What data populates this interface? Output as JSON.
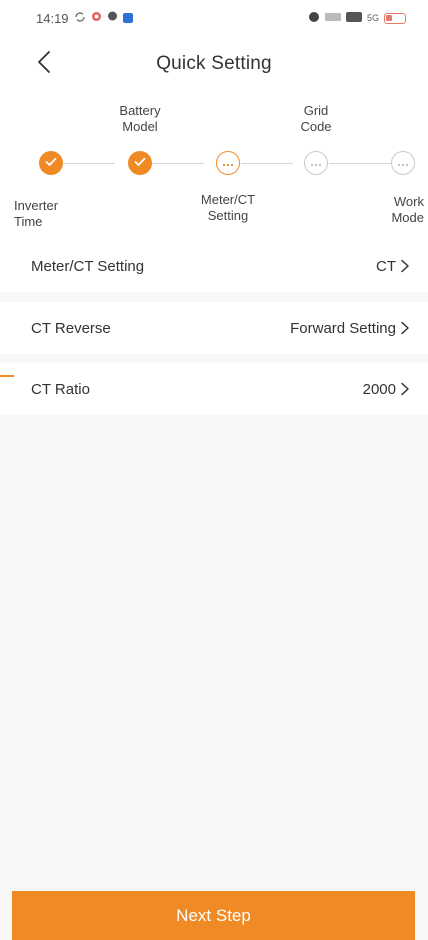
{
  "status_bar": {
    "time": "14:19",
    "right_text": "5G",
    "icons": [
      "sync-icon",
      "app-icon",
      "chat-icon",
      "notification-icon",
      "alarm-icon",
      "speed-icon",
      "hd-icon",
      "signal-icon",
      "battery-icon"
    ]
  },
  "header": {
    "title": "Quick Setting",
    "back_icon": "chevron-left-icon"
  },
  "stepper": {
    "accent_color": "#ef8a25",
    "steps": [
      {
        "label": "Inverter\nTime",
        "status": "done"
      },
      {
        "label": "Battery\nModel",
        "status": "done"
      },
      {
        "label": "Meter/CT\nSetting",
        "status": "current"
      },
      {
        "label": "Grid\nCode",
        "status": "todo"
      },
      {
        "label": "Work\nMode",
        "status": "todo"
      }
    ]
  },
  "settings": {
    "items": [
      {
        "label": "Meter/CT Setting",
        "value": "CT"
      },
      {
        "label": "CT Reverse",
        "value": "Forward Setting"
      },
      {
        "label": "CT Ratio",
        "value": "2000"
      }
    ]
  },
  "footer": {
    "next_label": "Next Step"
  }
}
